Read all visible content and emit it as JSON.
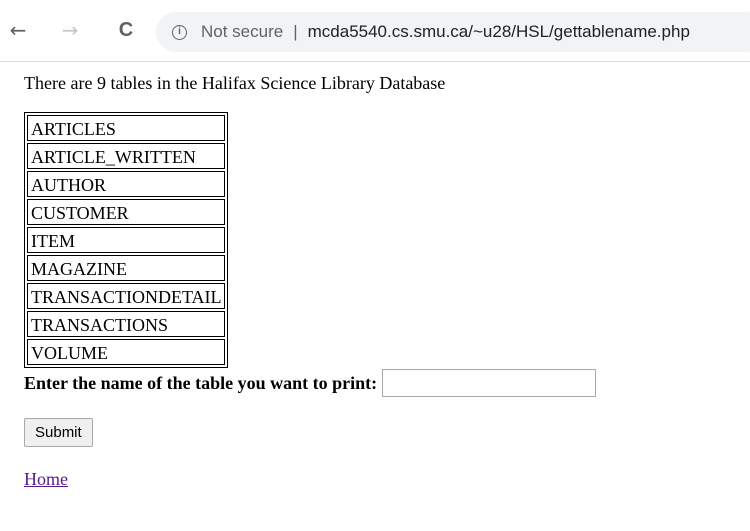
{
  "browser": {
    "back_icon": "←",
    "forward_icon": "→",
    "reload_icon": "C",
    "info_icon": "i",
    "security_label": "Not secure",
    "separator": "|",
    "url": "mcda5540.cs.smu.ca/~u28/HSL/gettablename.php"
  },
  "page": {
    "intro": "There are 9 tables in the Halifax Science Library Database",
    "tables": [
      {
        "name": "ARTICLES"
      },
      {
        "name": "ARTICLE_WRITTEN"
      },
      {
        "name": "AUTHOR"
      },
      {
        "name": "CUSTOMER"
      },
      {
        "name": "ITEM"
      },
      {
        "name": "MAGAZINE"
      },
      {
        "name": "TRANSACTIONDETAIL"
      },
      {
        "name": "TRANSACTIONS"
      },
      {
        "name": "VOLUME"
      }
    ],
    "prompt_label": "Enter the name of the table you want to print:",
    "input_value": "",
    "submit_label": "Submit",
    "home_link": "Home"
  }
}
